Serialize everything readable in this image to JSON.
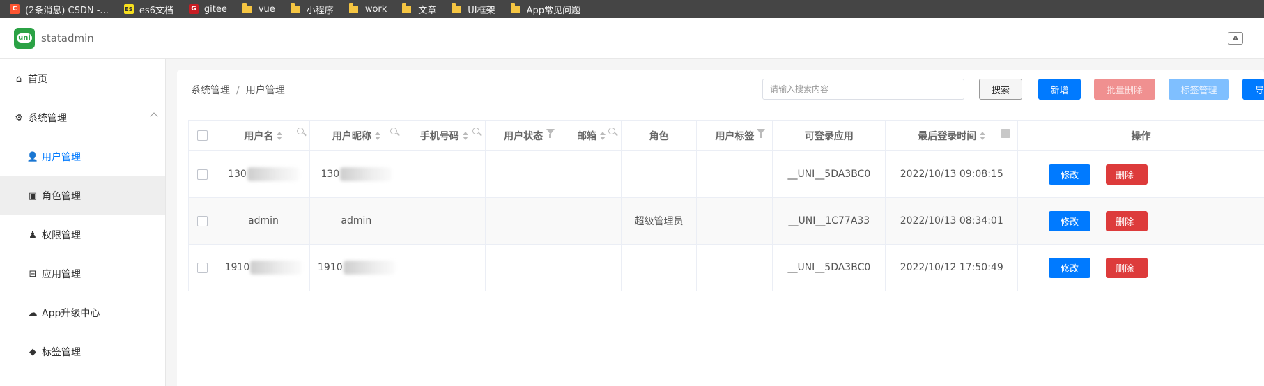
{
  "bookmarks": [
    {
      "label": "(2条消息) CSDN -...",
      "icon": "csdn-icon"
    },
    {
      "label": "es6文档",
      "icon": "es-icon"
    },
    {
      "label": "gitee",
      "icon": "gitee-icon"
    },
    {
      "label": "vue",
      "icon": "folder-icon"
    },
    {
      "label": "小程序",
      "icon": "folder-icon"
    },
    {
      "label": "work",
      "icon": "folder-icon"
    },
    {
      "label": "文章",
      "icon": "folder-icon"
    },
    {
      "label": "UI框架",
      "icon": "folder-icon"
    },
    {
      "label": "App常见问题",
      "icon": "folder-icon"
    }
  ],
  "header": {
    "logo_text": "uni",
    "app_name": "statadmin",
    "translate_icon": "translate-icon",
    "translate_glyph": "A"
  },
  "sidebar": {
    "items": [
      {
        "label": "首页",
        "icon": "home-icon",
        "glyph": "⌂"
      },
      {
        "label": "系统管理",
        "icon": "gear-icon",
        "glyph": "⚙"
      },
      {
        "label": "用户管理",
        "icon": "user-icon",
        "glyph": "👤"
      },
      {
        "label": "角色管理",
        "icon": "role-icon",
        "glyph": "▣"
      },
      {
        "label": "权限管理",
        "icon": "permission-icon",
        "glyph": "♟"
      },
      {
        "label": "应用管理",
        "icon": "app-icon",
        "glyph": "⊟"
      },
      {
        "label": "App升级中心",
        "icon": "cloud-upload-icon",
        "glyph": "☁"
      },
      {
        "label": "标签管理",
        "icon": "tag-icon",
        "glyph": "◆"
      }
    ]
  },
  "breadcrumb": {
    "items": [
      "系统管理",
      "用户管理"
    ],
    "separator": "/"
  },
  "toolbar": {
    "search_placeholder": "请输入搜索内容",
    "search_label": "搜索",
    "add_label": "新增",
    "batch_delete_label": "批量删除",
    "tag_manage_label": "标签管理",
    "export_label": "导"
  },
  "table": {
    "columns": [
      "用户名",
      "用户昵称",
      "手机号码",
      "用户状态",
      "邮箱",
      "角色",
      "用户标签",
      "可登录应用",
      "最后登录时间",
      "操作"
    ],
    "rows": [
      {
        "username": "130",
        "nickname": "130",
        "phone": "",
        "status": "",
        "email": "",
        "role": "",
        "tags": "",
        "app": "__UNI__5DA3BC0",
        "last_login": "2022/10/13 09:08:15",
        "edit": "修改",
        "delete": "删除"
      },
      {
        "username": "admin",
        "nickname": "admin",
        "phone": "",
        "status": "",
        "email": "",
        "role": "超级管理员",
        "tags": "",
        "app": "__UNI__1C77A33",
        "last_login": "2022/10/13 08:34:01",
        "edit": "修改",
        "delete": "删除"
      },
      {
        "username": "1910",
        "nickname": "1910",
        "phone": "",
        "status": "",
        "email": "",
        "role": "",
        "tags": "",
        "app": "__UNI__5DA3BC0",
        "last_login": "2022/10/12 17:50:49",
        "edit": "修改",
        "delete": "删除"
      }
    ]
  },
  "colors": {
    "primary": "#007aff",
    "danger": "#dd3b3b",
    "brand": "#2ba245"
  }
}
